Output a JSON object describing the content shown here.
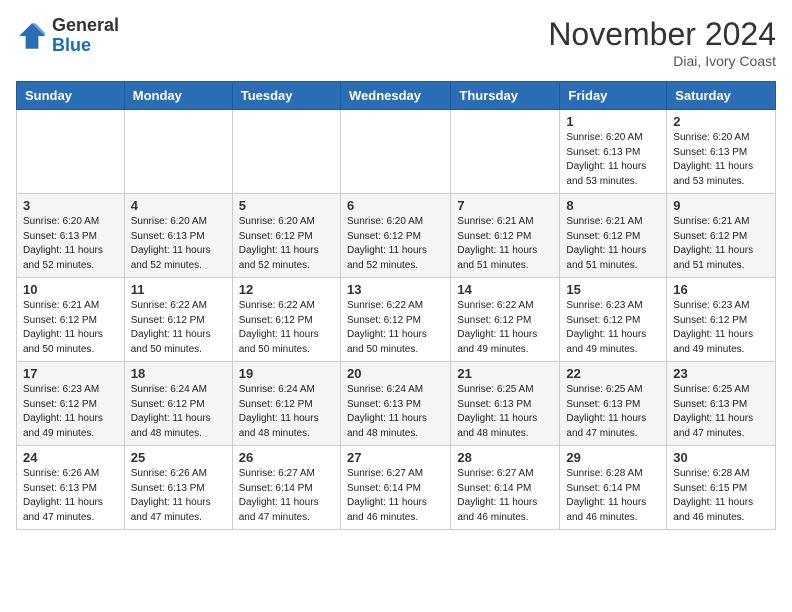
{
  "logo": {
    "general": "General",
    "blue": "Blue"
  },
  "header": {
    "month": "November 2024",
    "location": "Diai, Ivory Coast"
  },
  "days": [
    "Sunday",
    "Monday",
    "Tuesday",
    "Wednesday",
    "Thursday",
    "Friday",
    "Saturday"
  ],
  "weeks": [
    [
      {
        "day": "",
        "content": ""
      },
      {
        "day": "",
        "content": ""
      },
      {
        "day": "",
        "content": ""
      },
      {
        "day": "",
        "content": ""
      },
      {
        "day": "",
        "content": ""
      },
      {
        "day": "1",
        "content": "Sunrise: 6:20 AM\nSunset: 6:13 PM\nDaylight: 11 hours and 53 minutes."
      },
      {
        "day": "2",
        "content": "Sunrise: 6:20 AM\nSunset: 6:13 PM\nDaylight: 11 hours and 53 minutes."
      }
    ],
    [
      {
        "day": "3",
        "content": "Sunrise: 6:20 AM\nSunset: 6:13 PM\nDaylight: 11 hours and 52 minutes."
      },
      {
        "day": "4",
        "content": "Sunrise: 6:20 AM\nSunset: 6:13 PM\nDaylight: 11 hours and 52 minutes."
      },
      {
        "day": "5",
        "content": "Sunrise: 6:20 AM\nSunset: 6:12 PM\nDaylight: 11 hours and 52 minutes."
      },
      {
        "day": "6",
        "content": "Sunrise: 6:20 AM\nSunset: 6:12 PM\nDaylight: 11 hours and 52 minutes."
      },
      {
        "day": "7",
        "content": "Sunrise: 6:21 AM\nSunset: 6:12 PM\nDaylight: 11 hours and 51 minutes."
      },
      {
        "day": "8",
        "content": "Sunrise: 6:21 AM\nSunset: 6:12 PM\nDaylight: 11 hours and 51 minutes."
      },
      {
        "day": "9",
        "content": "Sunrise: 6:21 AM\nSunset: 6:12 PM\nDaylight: 11 hours and 51 minutes."
      }
    ],
    [
      {
        "day": "10",
        "content": "Sunrise: 6:21 AM\nSunset: 6:12 PM\nDaylight: 11 hours and 50 minutes."
      },
      {
        "day": "11",
        "content": "Sunrise: 6:22 AM\nSunset: 6:12 PM\nDaylight: 11 hours and 50 minutes."
      },
      {
        "day": "12",
        "content": "Sunrise: 6:22 AM\nSunset: 6:12 PM\nDaylight: 11 hours and 50 minutes."
      },
      {
        "day": "13",
        "content": "Sunrise: 6:22 AM\nSunset: 6:12 PM\nDaylight: 11 hours and 50 minutes."
      },
      {
        "day": "14",
        "content": "Sunrise: 6:22 AM\nSunset: 6:12 PM\nDaylight: 11 hours and 49 minutes."
      },
      {
        "day": "15",
        "content": "Sunrise: 6:23 AM\nSunset: 6:12 PM\nDaylight: 11 hours and 49 minutes."
      },
      {
        "day": "16",
        "content": "Sunrise: 6:23 AM\nSunset: 6:12 PM\nDaylight: 11 hours and 49 minutes."
      }
    ],
    [
      {
        "day": "17",
        "content": "Sunrise: 6:23 AM\nSunset: 6:12 PM\nDaylight: 11 hours and 49 minutes."
      },
      {
        "day": "18",
        "content": "Sunrise: 6:24 AM\nSunset: 6:12 PM\nDaylight: 11 hours and 48 minutes."
      },
      {
        "day": "19",
        "content": "Sunrise: 6:24 AM\nSunset: 6:12 PM\nDaylight: 11 hours and 48 minutes."
      },
      {
        "day": "20",
        "content": "Sunrise: 6:24 AM\nSunset: 6:13 PM\nDaylight: 11 hours and 48 minutes."
      },
      {
        "day": "21",
        "content": "Sunrise: 6:25 AM\nSunset: 6:13 PM\nDaylight: 11 hours and 48 minutes."
      },
      {
        "day": "22",
        "content": "Sunrise: 6:25 AM\nSunset: 6:13 PM\nDaylight: 11 hours and 47 minutes."
      },
      {
        "day": "23",
        "content": "Sunrise: 6:25 AM\nSunset: 6:13 PM\nDaylight: 11 hours and 47 minutes."
      }
    ],
    [
      {
        "day": "24",
        "content": "Sunrise: 6:26 AM\nSunset: 6:13 PM\nDaylight: 11 hours and 47 minutes."
      },
      {
        "day": "25",
        "content": "Sunrise: 6:26 AM\nSunset: 6:13 PM\nDaylight: 11 hours and 47 minutes."
      },
      {
        "day": "26",
        "content": "Sunrise: 6:27 AM\nSunset: 6:14 PM\nDaylight: 11 hours and 47 minutes."
      },
      {
        "day": "27",
        "content": "Sunrise: 6:27 AM\nSunset: 6:14 PM\nDaylight: 11 hours and 46 minutes."
      },
      {
        "day": "28",
        "content": "Sunrise: 6:27 AM\nSunset: 6:14 PM\nDaylight: 11 hours and 46 minutes."
      },
      {
        "day": "29",
        "content": "Sunrise: 6:28 AM\nSunset: 6:14 PM\nDaylight: 11 hours and 46 minutes."
      },
      {
        "day": "30",
        "content": "Sunrise: 6:28 AM\nSunset: 6:15 PM\nDaylight: 11 hours and 46 minutes."
      }
    ]
  ]
}
